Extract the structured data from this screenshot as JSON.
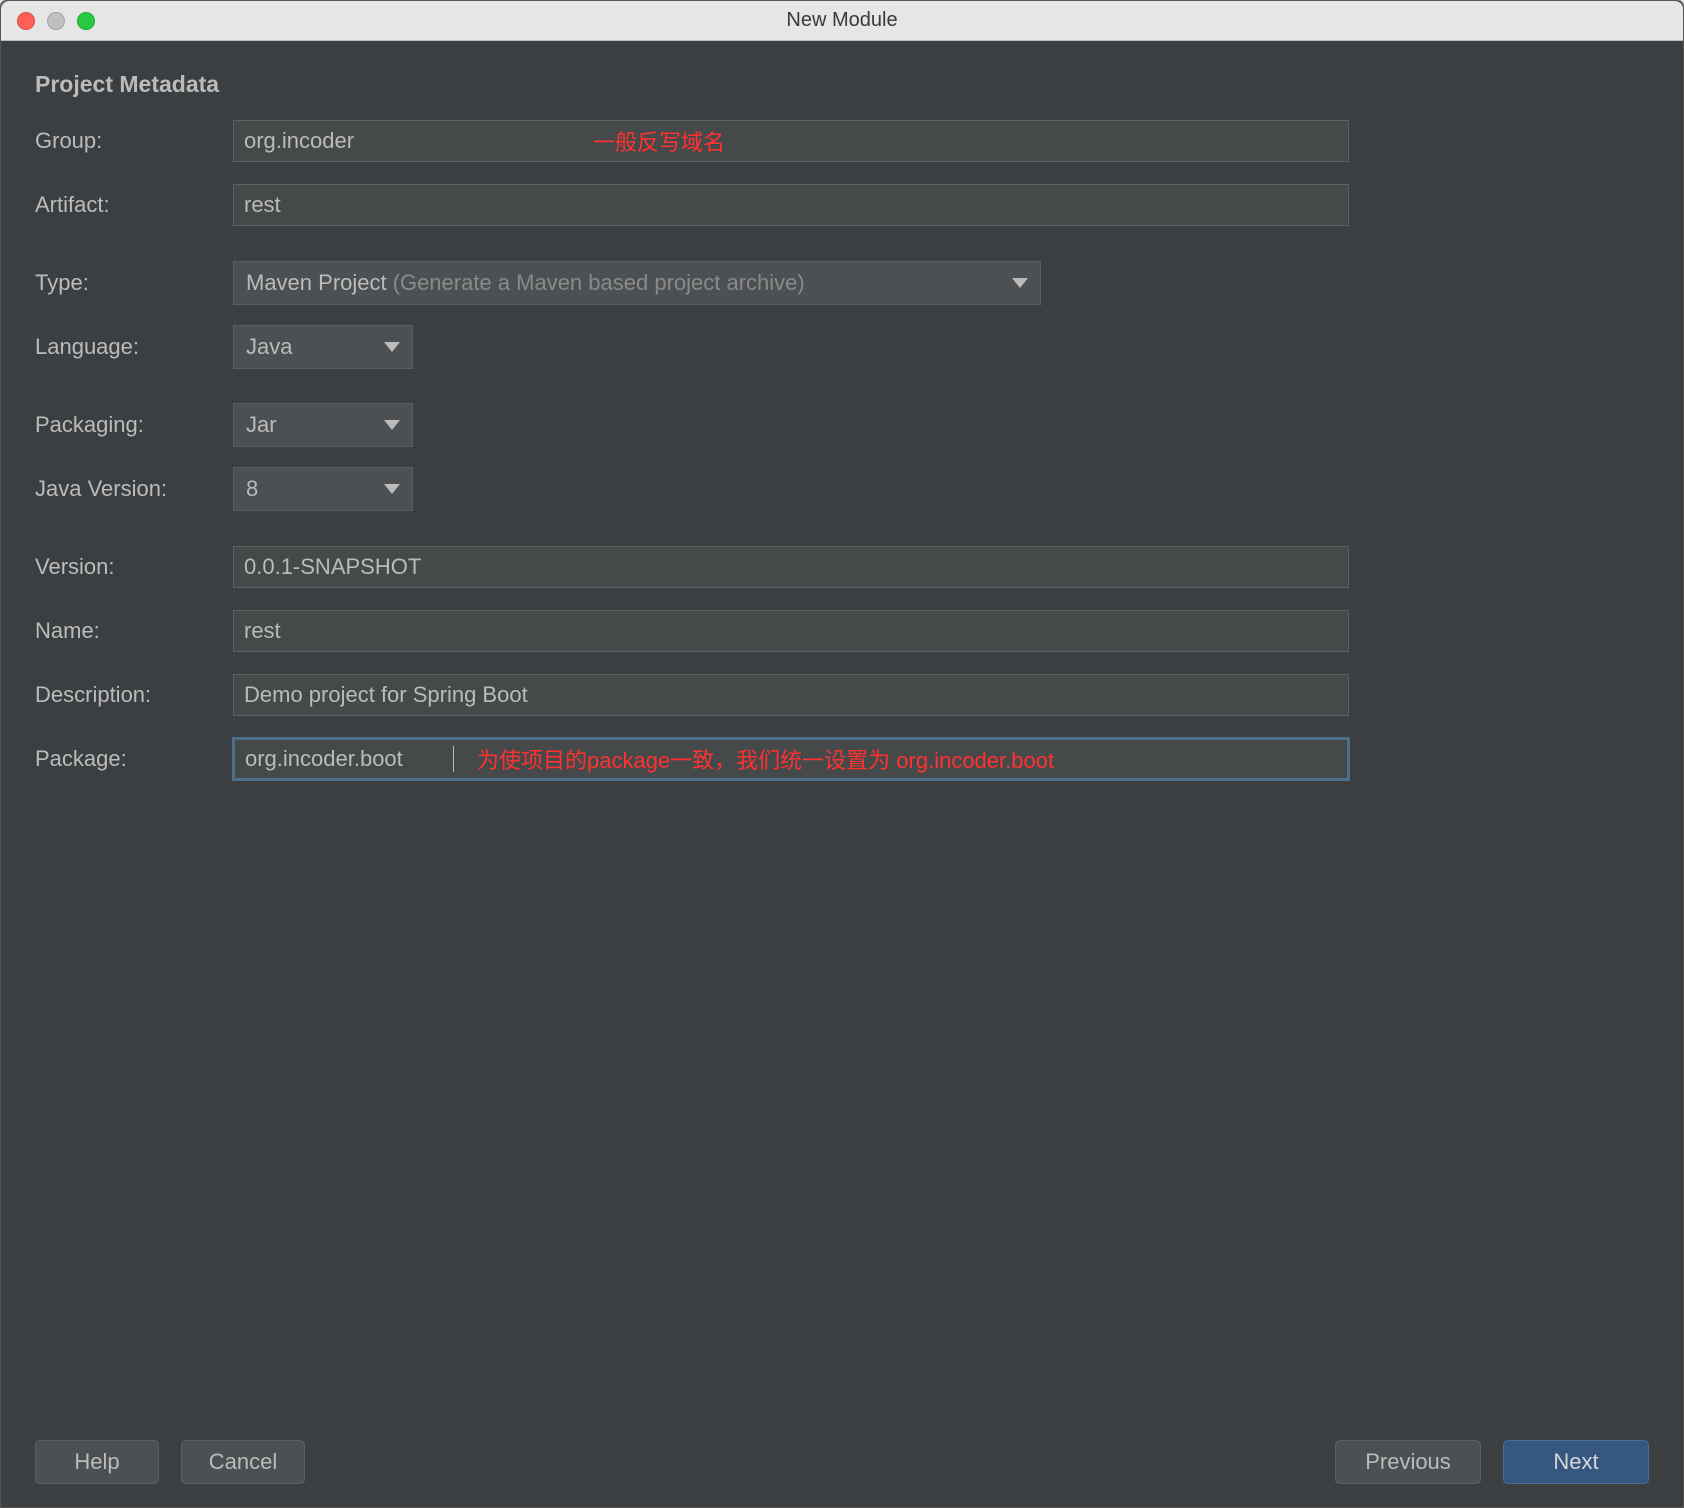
{
  "window": {
    "title": "New Module"
  },
  "section": {
    "title": "Project Metadata"
  },
  "labels": {
    "group": "Group:",
    "artifact": "Artifact:",
    "type": "Type:",
    "language": "Language:",
    "packaging": "Packaging:",
    "javaVersion": "Java Version:",
    "version": "Version:",
    "name": "Name:",
    "description": "Description:",
    "package": "Package:"
  },
  "fields": {
    "group": "org.incoder",
    "artifact": "rest",
    "type": {
      "value": "Maven Project",
      "hint": "(Generate a Maven based project archive)"
    },
    "language": "Java",
    "packaging": "Jar",
    "javaVersion": "8",
    "version": "0.0.1-SNAPSHOT",
    "name": "rest",
    "description": "Demo project for Spring Boot",
    "package": "org.incoder.boot"
  },
  "annotations": {
    "group": "一般反写域名",
    "package": "为使项目的package一致，我们统一设置为 org.incoder.boot"
  },
  "buttons": {
    "help": "Help",
    "cancel": "Cancel",
    "previous": "Previous",
    "next": "Next"
  }
}
